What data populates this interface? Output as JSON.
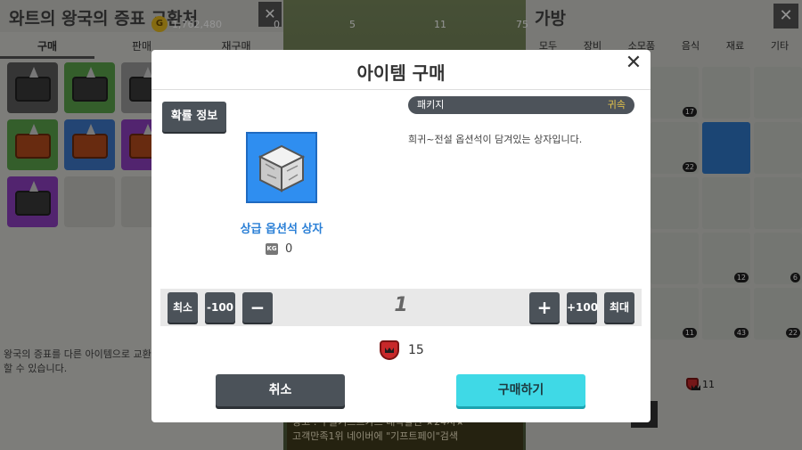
{
  "background": {
    "shop_title": "와트의 왕국의 증표 교환처",
    "shop_tabs": [
      "구매",
      "판매",
      "재구매"
    ],
    "shop_note": "왕국의 증표를 다른 아이템으로 교환할 수 있습니다.",
    "currency": {
      "gold": "1,762,480",
      "gold_symbol": "G",
      "item_a": "0",
      "item_b": "5",
      "item_c": "11",
      "item_d": "75"
    },
    "bag_title": "가방",
    "bag_tabs": [
      "모두",
      "장비",
      "소모품",
      "음식",
      "재료",
      "기타"
    ],
    "bag_counts": [
      "17",
      "22",
      "12",
      "6",
      "11",
      "43",
      "22"
    ],
    "bag_token_count": "11",
    "ticker_lines": [
      "광고 : 구글기프트카드 대박할인 ★24시★",
      "고객만족1위 네이버에 \"기프트페이\"검색"
    ],
    "close_glyph": "✕"
  },
  "modal": {
    "title": "아이템 구매",
    "close_glyph": "✕",
    "probability_button": "확률 정보",
    "item_name": "상급 옵션석 상자",
    "weight_label": "KG",
    "weight_value": "0",
    "package_label": "패키지",
    "bound_label": "귀속",
    "description": "희귀~전설 옵션석이 담겨있는 상자입니다.",
    "quantity": {
      "min_label": "최소",
      "minus100_label": "-100",
      "minus_label": "−",
      "value": "1",
      "plus_label": "+",
      "plus100_label": "+100",
      "max_label": "최대"
    },
    "cost_value": "15",
    "cancel_label": "취소",
    "buy_label": "구매하기"
  },
  "colors": {
    "buy_accent": "#3fd9e6",
    "item_name": "#2a7fd6",
    "item_bg": "#2f8ef0",
    "bound": "#e5c44a"
  }
}
